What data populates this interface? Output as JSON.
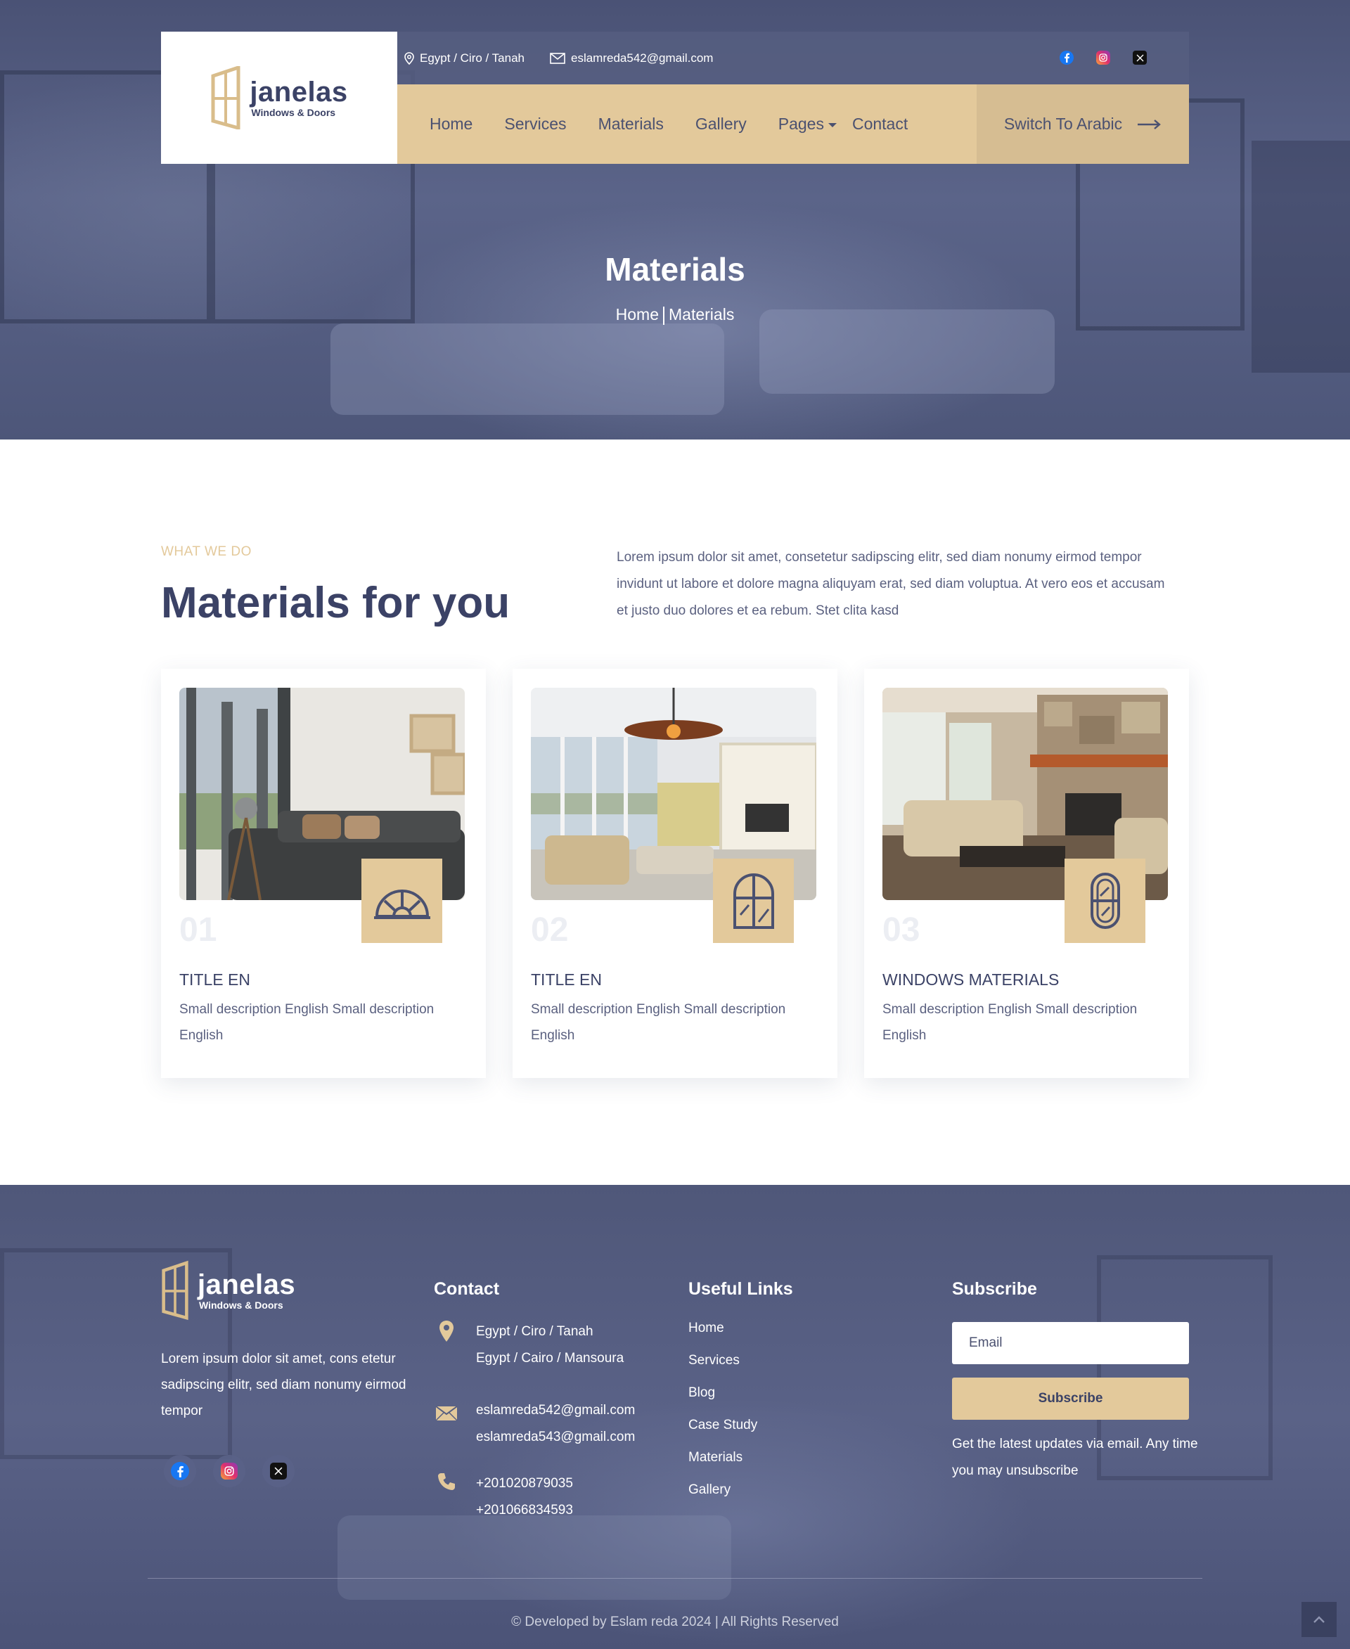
{
  "header": {
    "logo": {
      "name": "janelas",
      "tagline": "Windows & Doors"
    },
    "location": "Egypt / Ciro / Tanah",
    "email": "eslamreda542@gmail.com",
    "nav": {
      "home": "Home",
      "services": "Services",
      "materials": "Materials",
      "gallery": "Gallery",
      "pages": "Pages",
      "contact": "Contact"
    },
    "switch_language": "Switch To Arabic",
    "socials": [
      "facebook-icon",
      "instagram-icon",
      "x-icon"
    ]
  },
  "hero": {
    "title": "Materials",
    "breadcrumb": {
      "home": "Home",
      "current": "Materials"
    }
  },
  "section": {
    "eyebrow": "WHAT WE DO",
    "title": "Materials for you",
    "description": "Lorem ipsum dolor sit amet, consetetur sadipscing elitr, sed diam nonumy eirmod tempor invidunt ut labore et dolore magna aliquyam erat, sed diam voluptua. At vero eos et accusam et justo duo dolores et ea rebum. Stet clita kasd"
  },
  "cards": [
    {
      "number": "01",
      "title": "TITLE EN",
      "description": "Small description English Small description English",
      "icon": "arched-window-icon"
    },
    {
      "number": "02",
      "title": "TITLE EN",
      "description": "Small description English Small description English",
      "icon": "french-window-icon"
    },
    {
      "number": "03",
      "title": "WINDOWS MATERIALS",
      "description": "Small description English Small description English",
      "icon": "oval-window-icon"
    }
  ],
  "footer": {
    "logo": {
      "name": "janelas",
      "tagline": "Windows & Doors"
    },
    "about": "Lorem ipsum dolor sit amet, cons etetur sadipscing elitr, sed diam nonumy eirmod tempor",
    "contact_heading": "Contact",
    "addresses": [
      "Egypt / Ciro / Tanah",
      "Egypt / Cairo / Mansoura"
    ],
    "emails": [
      "eslamreda542@gmail.com",
      "eslamreda543@gmail.com"
    ],
    "phones": [
      "+201020879035",
      "+201066834593"
    ],
    "links_heading": "Useful Links",
    "links": [
      "Home",
      "Services",
      "Blog",
      "Case Study",
      "Materials",
      "Gallery"
    ],
    "subscribe_heading": "Subscribe",
    "email_placeholder": "Email",
    "subscribe_button": "Subscribe",
    "subscribe_note": "Get the latest updates via email. Any time you may unsubscribe",
    "copyright": "© Developed by Eslam reda  2024 | All Rights Reserved"
  },
  "colors": {
    "navy": "#3b4266",
    "gold": "#e3c99b",
    "hero_overlay": "#565e80"
  }
}
